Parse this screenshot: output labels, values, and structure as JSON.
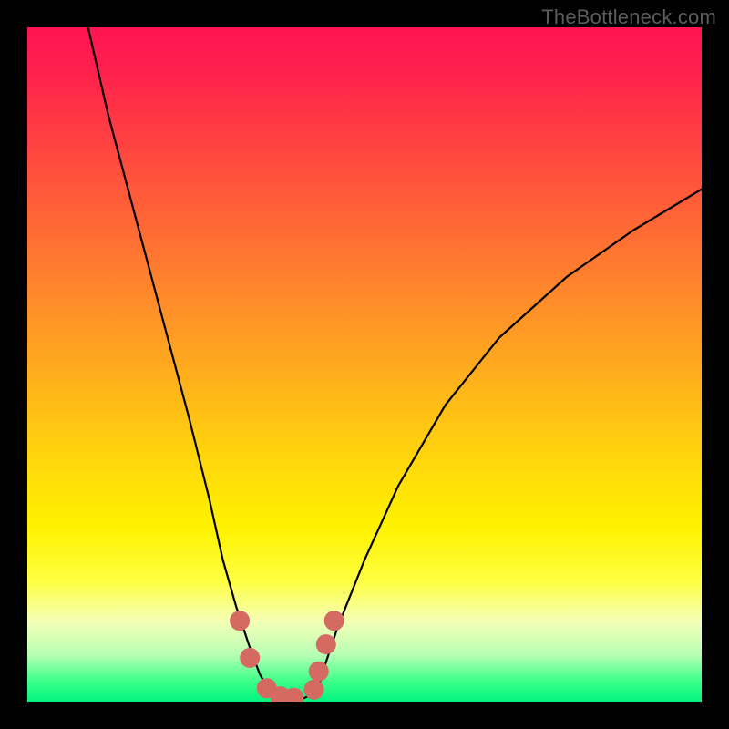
{
  "watermark": "TheBottleneck.com",
  "chart_data": {
    "type": "line",
    "title": "",
    "xlabel": "",
    "ylabel": "",
    "xlim": [
      0,
      100
    ],
    "ylim": [
      0,
      100
    ],
    "series": [
      {
        "name": "bottleneck-curve",
        "x": [
          9,
          12,
          16,
          20,
          24,
          27,
          29,
          31,
          33,
          34.5,
          36,
          38,
          41,
          43,
          44,
          46,
          50,
          55,
          62,
          70,
          80,
          90,
          100
        ],
        "values": [
          100,
          87,
          72,
          57,
          42,
          30,
          21,
          14,
          8,
          4,
          1.5,
          0.5,
          0.5,
          1.5,
          5,
          11,
          21,
          32,
          44,
          54,
          63,
          70,
          76
        ]
      }
    ],
    "markers": {
      "name": "highlight-dots",
      "x": [
        31.5,
        33,
        35.5,
        37.5,
        39.5,
        42.5,
        43.2,
        44.3,
        45.5
      ],
      "values": [
        12,
        6.5,
        2,
        0.8,
        0.6,
        1.8,
        4.5,
        8.5,
        12
      ],
      "color": "#d46a62",
      "size": 22
    },
    "gradient_stops": [
      {
        "pos": 0.0,
        "color": "#ff1452"
      },
      {
        "pos": 0.3,
        "color": "#ff6a34"
      },
      {
        "pos": 0.64,
        "color": "#ffd60c"
      },
      {
        "pos": 0.82,
        "color": "#ffff40"
      },
      {
        "pos": 0.97,
        "color": "#3cff89"
      },
      {
        "pos": 1.0,
        "color": "#00f57f"
      }
    ]
  }
}
